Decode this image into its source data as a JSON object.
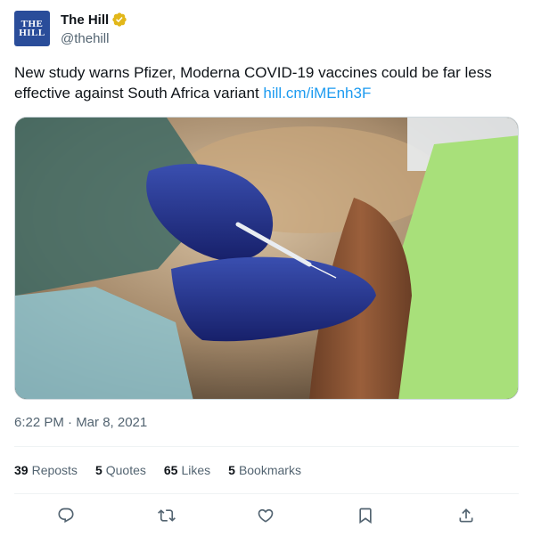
{
  "account": {
    "display_name": "The Hill",
    "handle": "@thehill",
    "avatar_text_line1": "THE",
    "avatar_text_line2": "HILL",
    "verified_icon": "verified-badge-icon",
    "verified_color": "#e2b719"
  },
  "tweet": {
    "text": "New study warns Pfizer, Moderna COVID-19 vaccines could be far less effective against South Africa variant",
    "link": "hill.cm/iMEnh3F",
    "timestamp": "6:22 PM · Mar 8, 2021"
  },
  "stats": [
    {
      "count": "39",
      "label": "Reposts"
    },
    {
      "count": "5",
      "label": "Quotes"
    },
    {
      "count": "65",
      "label": "Likes"
    },
    {
      "count": "5",
      "label": "Bookmarks"
    }
  ],
  "actions": [
    {
      "icon": "reply-icon"
    },
    {
      "icon": "repost-icon"
    },
    {
      "icon": "like-icon"
    },
    {
      "icon": "bookmark-icon"
    },
    {
      "icon": "share-icon"
    }
  ],
  "colors": {
    "text": "#0f1419",
    "secondary": "#536471",
    "link": "#1d9bf0",
    "avatar_bg": "#2a4d9a"
  }
}
